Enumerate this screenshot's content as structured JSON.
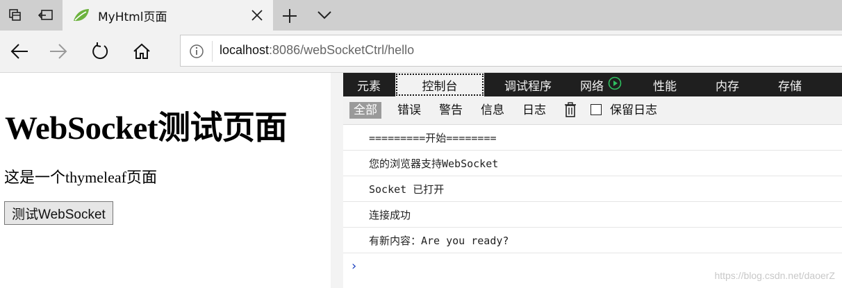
{
  "browser": {
    "tab_title": "MyHtml页面",
    "url_host": "localhost",
    "url_rest": ":8086/webSocketCtrl/hello"
  },
  "page": {
    "heading": "WebSocket测试页面",
    "paragraph": "这是一个thymeleaf页面",
    "button_label": "测试WebSocket"
  },
  "devtools": {
    "tabs": [
      "元素",
      "控制台",
      "调试程序",
      "网络",
      "性能",
      "内存",
      "存储"
    ],
    "active_tab": "控制台",
    "filters": [
      "全部",
      "错误",
      "警告",
      "信息",
      "日志"
    ],
    "active_filter": "全部",
    "keep_log_label": "保留日志",
    "console_lines": [
      "=========开始========",
      "您的浏览器支持WebSocket",
      "Socket 已打开",
      "连接成功",
      "有新内容：Are you ready?"
    ],
    "prompt_symbol": "›"
  },
  "watermark": "https://blog.csdn.net/daoerZ",
  "colors": {
    "devtools_tab_bar": "#1f1f1f",
    "prompt": "#1a3fbf",
    "spring_leaf": "#6db33f"
  }
}
